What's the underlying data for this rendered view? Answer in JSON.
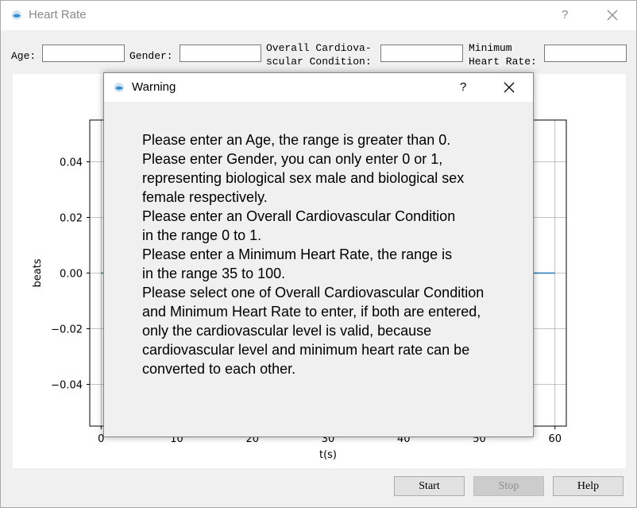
{
  "window": {
    "title": "Heart Rate",
    "help_glyph": "?",
    "icon": "app-icon"
  },
  "inputs": {
    "age_label": "Age:",
    "gender_label": "Gender:",
    "cardio_label_line1": "Overall Cardiova-",
    "cardio_label_line2": "scular Condition:",
    "minhr_label_line1": "Minimum",
    "minhr_label_line2": "Heart Rate:",
    "age_value": "",
    "gender_value": "",
    "cardio_value": "",
    "minhr_value": ""
  },
  "chart_data": {
    "type": "line",
    "xlabel": "t(s)",
    "ylabel": "beats",
    "xlim": [
      -1.5,
      61.5
    ],
    "ylim": [
      -0.055,
      0.055
    ],
    "x_ticks": [
      0,
      10,
      20,
      30,
      40,
      50,
      60
    ],
    "x_tick_labels": [
      "0",
      "10",
      "20",
      "30",
      "40",
      "50",
      "60"
    ],
    "y_ticks": [
      0.04,
      0.02,
      0.0,
      -0.02,
      -0.04
    ],
    "y_tick_labels": [
      "0.04",
      "0.02",
      "0.00",
      "−0.02",
      "−0.04"
    ],
    "grid": true,
    "series": [
      {
        "x": [
          0,
          60
        ],
        "y": [
          0.0,
          0.0
        ],
        "color": "#1f77b4"
      }
    ]
  },
  "buttons": {
    "start": "Start",
    "stop": "Stop",
    "help": "Help"
  },
  "dialog": {
    "title": "Warning",
    "help_glyph": "?",
    "lines": [
      "Please enter an Age, the range is greater than 0.",
      "Please enter Gender, you can only enter 0 or 1,",
      "representing biological sex male and biological sex",
      "female respectively.",
      "Please enter an Overall Cardiovascular Condition",
      "in the range 0 to 1.",
      "Please enter a Minimum Heart Rate, the range is",
      "in the range 35 to 100.",
      "Please select one of Overall Cardiovascular Condition",
      "and Minimum Heart Rate to enter, if both are entered,",
      "only the cardiovascular level is valid, because",
      "cardiovascular level and minimum heart rate can be",
      "converted to each other."
    ]
  }
}
